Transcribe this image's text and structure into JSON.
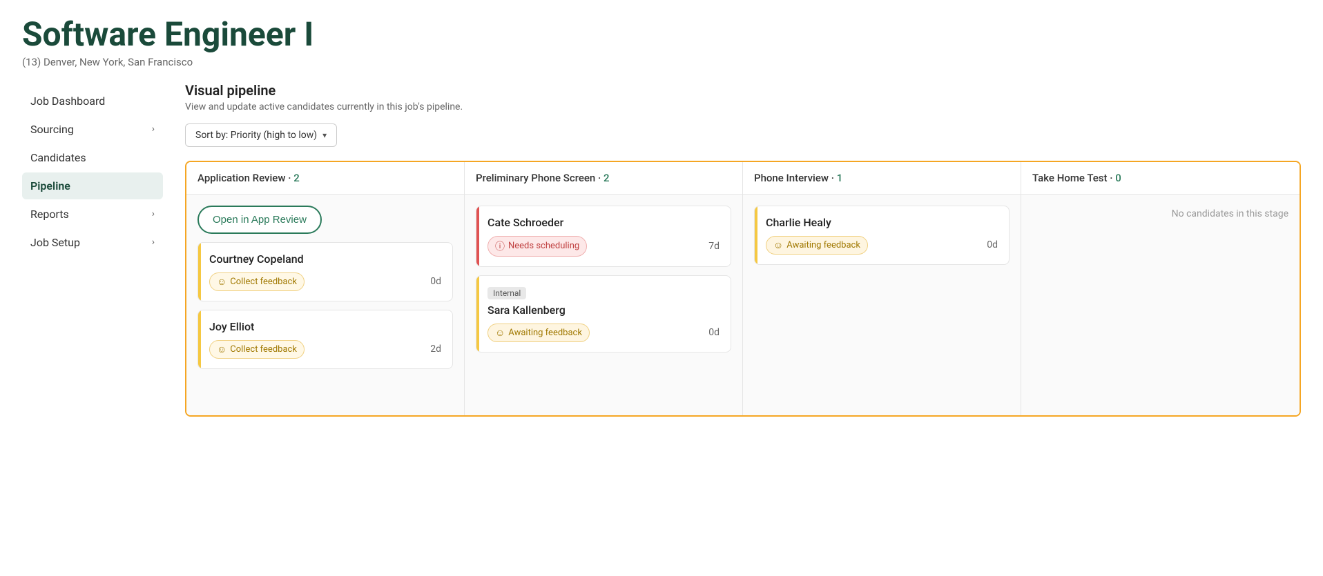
{
  "header": {
    "title": "Software Engineer I",
    "subtitle": "(13) Denver, New York, San Francisco"
  },
  "sidebar": {
    "items": [
      {
        "label": "Job Dashboard",
        "active": false,
        "hasChevron": false
      },
      {
        "label": "Sourcing",
        "active": false,
        "hasChevron": true
      },
      {
        "label": "Candidates",
        "active": false,
        "hasChevron": false
      },
      {
        "label": "Pipeline",
        "active": true,
        "hasChevron": false
      },
      {
        "label": "Reports",
        "active": false,
        "hasChevron": true
      },
      {
        "label": "Job Setup",
        "active": false,
        "hasChevron": true
      }
    ]
  },
  "main": {
    "section_title": "Visual pipeline",
    "section_desc": "View and update active candidates currently in this job's pipeline.",
    "sort_label": "Sort by: Priority (high to low)",
    "pipeline": {
      "columns": [
        {
          "title": "Application Review",
          "count": "2",
          "count_color": "#2a7a5a"
        },
        {
          "title": "Preliminary Phone Screen",
          "count": "2",
          "count_color": "#2a7a5a"
        },
        {
          "title": "Phone Interview",
          "count": "1",
          "count_color": "#2a7a5a"
        },
        {
          "title": "Take Home Test",
          "count": "0",
          "count_color": "#2a7a5a"
        }
      ],
      "col0": {
        "open_review_btn": "Open in App Review",
        "cards": [
          {
            "name": "Courtney Copeland",
            "status_type": "feedback",
            "status_label": "Collect feedback",
            "days": "0d",
            "border_color": "yellow"
          },
          {
            "name": "Joy Elliot",
            "status_type": "feedback",
            "status_label": "Collect feedback",
            "days": "2d",
            "border_color": "yellow"
          }
        ]
      },
      "col1": {
        "cards": [
          {
            "name": "Cate Schroeder",
            "status_type": "needs-scheduling",
            "status_label": "Needs scheduling",
            "days": "7d",
            "border_color": "red",
            "internal": false
          },
          {
            "name": "Sara Kallenberg",
            "status_type": "awaiting",
            "status_label": "Awaiting feedback",
            "days": "0d",
            "border_color": "yellow",
            "internal": true,
            "internal_label": "Internal"
          }
        ]
      },
      "col2": {
        "cards": [
          {
            "name": "Charlie Healy",
            "status_type": "awaiting",
            "status_label": "Awaiting feedback",
            "days": "0d",
            "border_color": "yellow"
          }
        ]
      },
      "col3": {
        "no_candidates_label": "No candidates in this stage"
      }
    }
  },
  "icons": {
    "chevron_right": "›",
    "dropdown_arrow": "▾",
    "smiley": "☺",
    "info": "ⓘ"
  }
}
